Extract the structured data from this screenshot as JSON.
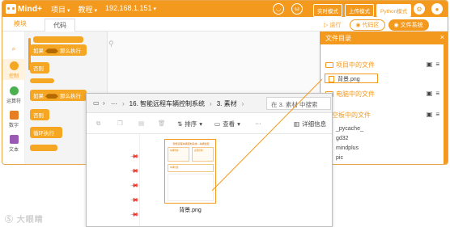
{
  "app": {
    "logo_text": "Mind+",
    "menu": [
      "项目",
      "教程"
    ],
    "ip": "192.168.1.151",
    "modes": [
      "实时模式",
      "上传模式",
      "Python模式"
    ],
    "accent": "#f39a1e"
  },
  "tabs": {
    "module": "模块",
    "code": "代码"
  },
  "run_buttons": {
    "run": "运行",
    "code": "代码区",
    "files": "文件系统"
  },
  "categories": [
    {
      "label": "控制",
      "color": "#f5a623"
    },
    {
      "label": "运算符",
      "color": "#4caf50"
    },
    {
      "label": "数字",
      "color": "#e67e22"
    },
    {
      "label": "文本",
      "color": "#9b59b6"
    }
  ],
  "blocks": {
    "if_then": "如果",
    "then_run": "那么执行",
    "else": "否则",
    "loop": "循环执行"
  },
  "file_panel": {
    "title": "文件目录",
    "close": "×",
    "section_project": "项目中的文件",
    "selected_file": "背景.png",
    "section_computer": "电脑中的文件",
    "section_board": "行空板中的文件",
    "board_files": [
      "_pycache_",
      "gd32",
      "mindplus",
      "pic"
    ]
  },
  "explorer": {
    "crumbs": [
      "16. 智能远程车辆控制系统",
      "3. 素材"
    ],
    "more": "···",
    "search_placeholder": "在 3. 素材 中搜索",
    "toolbar": {
      "sort": "排序",
      "view": "查看",
      "more": "···",
      "details": "详细信息"
    },
    "file": {
      "name": "背景.png",
      "thumb_title": "智能远程车辆控制系统—车辆监控",
      "thumb_box1": "车辆状态:",
      "thumb_box2": "远程控制:",
      "thumb_box3": "车辆位置:"
    }
  },
  "watermark": "Ⓢ 大眼睛"
}
